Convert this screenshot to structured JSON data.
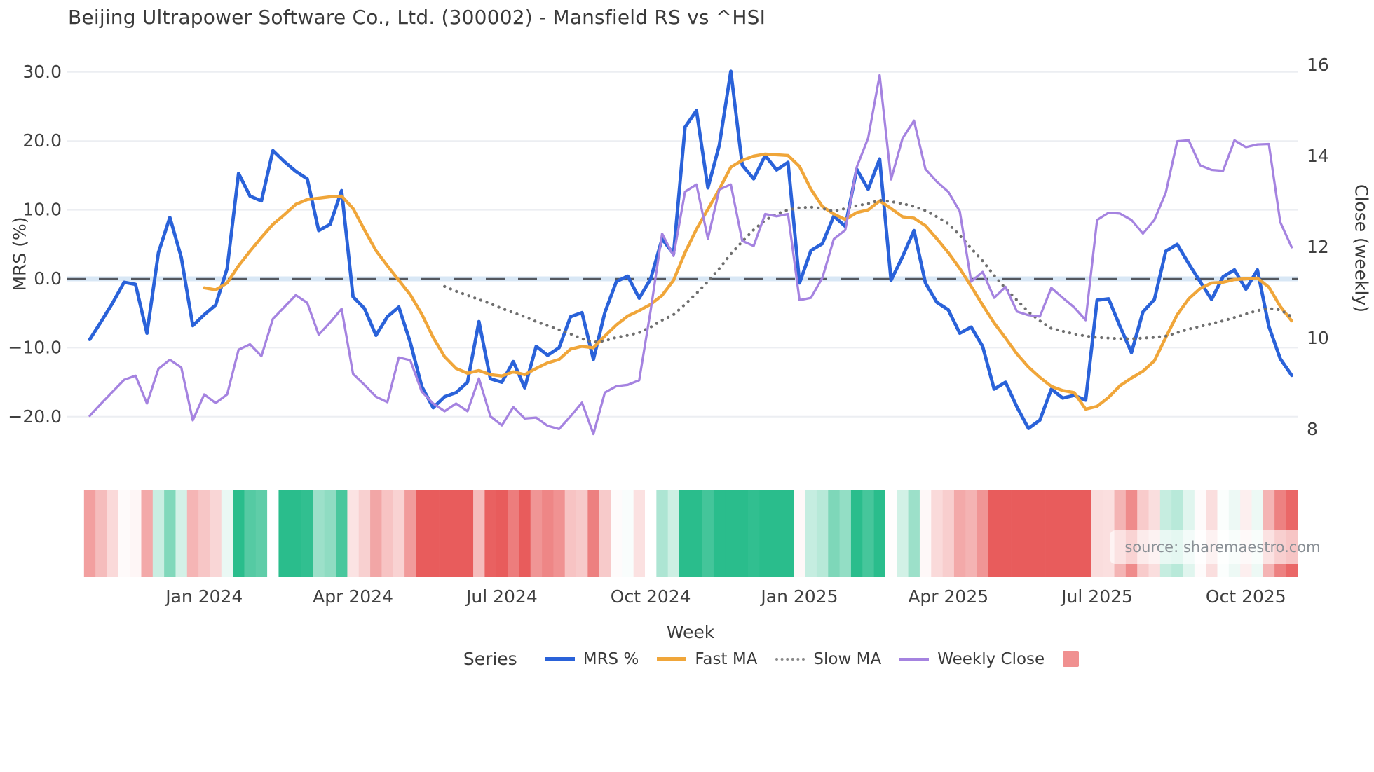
{
  "title": "Beijing Ultrapower Software Co., Ltd. (300002) - Mansfield RS vs ^HSI",
  "axes": {
    "left_label": "MRS (%)",
    "right_label": "Close (weekly)",
    "x_label": "Week",
    "left_ticks": [
      30.0,
      20.0,
      10.0,
      0.0,
      -10.0,
      -20.0
    ],
    "right_ticks": [
      16,
      14,
      12,
      10,
      8
    ],
    "x_tick_labels": [
      "Jan 2024",
      "Apr 2024",
      "Jul 2024",
      "Oct 2024",
      "Jan 2025",
      "Apr 2025",
      "Jul 2025",
      "Oct 2025"
    ],
    "x_tick_weeks": [
      10,
      23,
      36,
      49,
      62,
      75,
      88,
      101
    ]
  },
  "legend": {
    "title": "Series",
    "items": [
      {
        "label": "MRS %",
        "style": "line",
        "color": "#2a62d9",
        "thickness": 5
      },
      {
        "label": "Fast MA",
        "style": "line",
        "color": "#f0a63a",
        "thickness": 5
      },
      {
        "label": "Slow MA",
        "style": "dotted",
        "color": "#8a8a8a",
        "thickness": 4
      },
      {
        "label": "Weekly Close",
        "style": "line",
        "color": "#a583e0",
        "thickness": 4
      },
      {
        "label": "",
        "style": "patch",
        "color": "#f09090"
      }
    ]
  },
  "source_note": "source: sharemaestro.com",
  "chart_data": {
    "type": "line",
    "subcharts": [
      "dual-axis weekly line chart",
      "weekly heatmap strip colored by MRS %"
    ],
    "x_unit": "week index (weekly data, late Oct 2023 - early Nov 2025)",
    "x": "0..105",
    "left_axis_range": [
      -20,
      30
    ],
    "right_axis_range": [
      8,
      16
    ],
    "grid": "horizontal light gridlines at left ticks; dashed zero line",
    "legend_position": "bottom center",
    "zero_line": 0,
    "heatmap_rule": "cell color = diverging red-white-teal colormap of MRS %, saturated at +/-15; week 16 missing (white)",
    "heatmap_missing_weeks": [
      16
    ],
    "colors": {
      "mrs": "#2a62d9",
      "fast_ma": "#f0a63a",
      "slow_ma": "#6f6f6f",
      "weekly_close": "#a583e0",
      "heat_red": "#e85c5c",
      "heat_green": "#2abd8c",
      "gridline": "#eceef2",
      "zero_dash": "#53575e",
      "zero_band": "#d8e7f5",
      "tick_text": "#3f3f3f"
    },
    "series": [
      {
        "name": "MRS %",
        "axis": "left",
        "values": [
          -8.8,
          -6.2,
          -3.5,
          -0.5,
          -0.8,
          -7.9,
          3.8,
          8.9,
          3.1,
          -6.8,
          -5.2,
          -3.8,
          1.5,
          15.3,
          12.0,
          11.3,
          18.6,
          17.0,
          15.6,
          14.5,
          7.0,
          7.9,
          12.8,
          -2.6,
          -4.3,
          -8.2,
          -5.5,
          -4.1,
          -9.2,
          -15.6,
          -18.7,
          -17.1,
          -16.5,
          -15.0,
          -6.2,
          -14.5,
          -15.0,
          -12.0,
          -15.8,
          -9.8,
          -11.1,
          -10.0,
          -5.5,
          -4.9,
          -11.7,
          -4.9,
          -0.4,
          0.4,
          -2.8,
          0.0,
          5.8,
          3.6,
          22.0,
          24.4,
          13.2,
          19.4,
          30.1,
          16.5,
          14.5,
          17.9,
          15.8,
          16.9,
          -0.6,
          4.1,
          5.1,
          9.1,
          7.6,
          15.9,
          13.0,
          17.4,
          -0.2,
          3.2,
          7.0,
          -0.6,
          -3.4,
          -4.5,
          -7.9,
          -7.0,
          -9.8,
          -16.0,
          -15.0,
          -18.6,
          -21.7,
          -20.5,
          -16.0,
          -17.3,
          -16.9,
          -17.6,
          -3.1,
          -2.9,
          -6.9,
          -10.7,
          -4.8,
          -3.0,
          4.0,
          5.0,
          2.2,
          -0.4,
          -3.0,
          0.3,
          1.3,
          -1.5,
          1.3,
          -6.9,
          -11.6,
          -14.0
        ]
      },
      {
        "name": "Fast MA",
        "axis": "left",
        "values": [
          null,
          null,
          null,
          null,
          null,
          null,
          null,
          null,
          null,
          null,
          -1.3,
          -1.6,
          -0.6,
          1.9,
          4.0,
          6.0,
          7.9,
          9.3,
          10.8,
          11.5,
          11.7,
          11.9,
          12.0,
          10.2,
          7.1,
          4.1,
          1.9,
          -0.2,
          -2.3,
          -5.1,
          -8.5,
          -11.3,
          -13.0,
          -13.7,
          -13.3,
          -13.9,
          -14.1,
          -13.5,
          -13.9,
          -13.0,
          -12.2,
          -11.7,
          -10.2,
          -9.8,
          -10.0,
          -8.3,
          -6.7,
          -5.4,
          -4.6,
          -3.7,
          -2.4,
          -0.2,
          3.8,
          7.2,
          10.1,
          13.0,
          16.2,
          17.2,
          17.8,
          18.1,
          18.0,
          17.9,
          16.3,
          13.0,
          10.5,
          9.4,
          8.6,
          9.6,
          10.0,
          11.3,
          10.2,
          9.0,
          8.8,
          7.7,
          5.8,
          3.8,
          1.5,
          -1.1,
          -3.8,
          -6.4,
          -8.6,
          -10.9,
          -12.8,
          -14.3,
          -15.6,
          -16.2,
          -16.5,
          -18.9,
          -18.5,
          -17.2,
          -15.5,
          -14.4,
          -13.4,
          -11.9,
          -8.5,
          -5.2,
          -2.9,
          -1.4,
          -0.6,
          -0.5,
          -0.1,
          0.0,
          0.1,
          -1.2,
          -4.0,
          -6.1
        ]
      },
      {
        "name": "Slow MA",
        "axis": "left",
        "values": [
          null,
          null,
          null,
          null,
          null,
          null,
          null,
          null,
          null,
          null,
          null,
          null,
          null,
          null,
          null,
          null,
          null,
          null,
          null,
          null,
          null,
          null,
          null,
          null,
          null,
          null,
          null,
          null,
          null,
          null,
          null,
          -1.1,
          -1.8,
          -2.4,
          -3.0,
          -3.6,
          -4.3,
          -4.9,
          -5.5,
          -6.2,
          -6.8,
          -7.4,
          -8.0,
          -8.7,
          -9.2,
          -9.0,
          -8.5,
          -8.2,
          -7.8,
          -7.0,
          -6.0,
          -5.2,
          -3.7,
          -2.1,
          -0.4,
          1.5,
          3.6,
          5.4,
          7.1,
          8.5,
          9.4,
          10.0,
          10.3,
          10.4,
          10.2,
          9.8,
          10.2,
          10.6,
          10.9,
          11.4,
          11.2,
          10.9,
          10.5,
          9.9,
          9.0,
          8.0,
          6.3,
          4.4,
          2.6,
          0.5,
          -1.4,
          -3.1,
          -4.8,
          -6.1,
          -7.2,
          -7.6,
          -8.0,
          -8.3,
          -8.5,
          -8.6,
          -8.7,
          -8.7,
          -8.6,
          -8.5,
          -8.3,
          -7.8,
          -7.3,
          -6.9,
          -6.5,
          -6.1,
          -5.6,
          -5.1,
          -4.6,
          -4.3,
          -4.5,
          -5.5
        ]
      },
      {
        "name": "Weekly Close",
        "axis": "right",
        "values": [
          8.3,
          8.57,
          8.83,
          9.09,
          9.18,
          8.57,
          9.33,
          9.53,
          9.36,
          8.2,
          8.77,
          8.58,
          8.77,
          9.75,
          9.87,
          9.61,
          10.43,
          10.69,
          10.95,
          10.78,
          10.08,
          10.35,
          10.65,
          9.22,
          8.98,
          8.72,
          8.6,
          9.58,
          9.52,
          8.83,
          8.57,
          8.4,
          8.57,
          8.4,
          9.12,
          8.29,
          8.09,
          8.49,
          8.24,
          8.26,
          8.08,
          8.01,
          8.29,
          8.59,
          7.9,
          8.81,
          8.95,
          8.98,
          9.08,
          10.62,
          12.3,
          11.81,
          13.22,
          13.38,
          12.19,
          13.27,
          13.38,
          12.14,
          12.03,
          12.73,
          12.68,
          12.73,
          10.84,
          10.89,
          11.33,
          12.18,
          12.38,
          13.76,
          14.4,
          15.78,
          13.49,
          14.39,
          14.78,
          13.72,
          13.44,
          13.22,
          12.79,
          11.25,
          11.46,
          10.89,
          11.13,
          10.59,
          10.51,
          10.48,
          11.11,
          10.89,
          10.68,
          10.4,
          12.6,
          12.76,
          12.74,
          12.6,
          12.3,
          12.6,
          13.2,
          14.33,
          14.35,
          13.8,
          13.7,
          13.68,
          14.35,
          14.2,
          14.26,
          14.27,
          12.55,
          12.0
        ]
      }
    ]
  }
}
